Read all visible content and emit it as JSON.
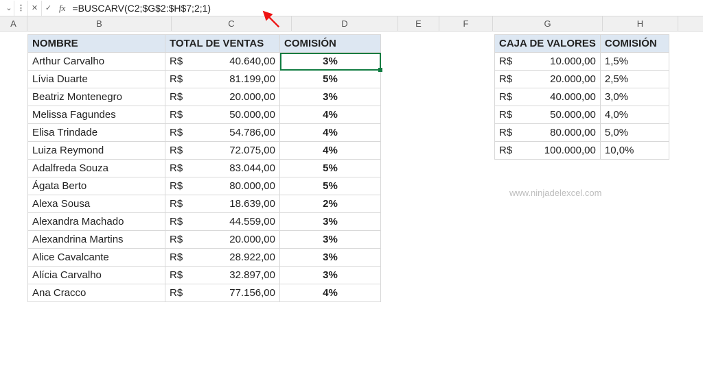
{
  "formula_bar": {
    "dropdown_icon": "⌄",
    "cancel_icon": "✕",
    "accept_icon": "✓",
    "fx_label": "fx",
    "formula": "=BUSCARV(C2;$G$2:$H$7;2;1)"
  },
  "columns": {
    "A": "A",
    "B": "B",
    "C": "C",
    "D": "D",
    "E": "E",
    "F": "F",
    "G": "G",
    "H": "H"
  },
  "main": {
    "headers": {
      "name": "NOMBRE",
      "total": "TOTAL DE VENTAS",
      "comm": "COMISIÓN"
    },
    "currency": "R$",
    "rows": [
      {
        "name": "Arthur Carvalho",
        "total": "40.640,00",
        "pct": "3%"
      },
      {
        "name": "Lívia Duarte",
        "total": "81.199,00",
        "pct": "5%"
      },
      {
        "name": "Beatriz Montenegro",
        "total": "20.000,00",
        "pct": "3%"
      },
      {
        "name": "Melissa Fagundes",
        "total": "50.000,00",
        "pct": "4%"
      },
      {
        "name": "Elisa Trindade",
        "total": "54.786,00",
        "pct": "4%"
      },
      {
        "name": "Luiza Reymond",
        "total": "72.075,00",
        "pct": "4%"
      },
      {
        "name": "Adalfreda Souza",
        "total": "83.044,00",
        "pct": "5%"
      },
      {
        "name": "Ágata Berto",
        "total": "80.000,00",
        "pct": "5%"
      },
      {
        "name": "Alexa Sousa",
        "total": "18.639,00",
        "pct": "2%"
      },
      {
        "name": "Alexandra Machado",
        "total": "44.559,00",
        "pct": "3%"
      },
      {
        "name": "Alexandrina Martins",
        "total": "20.000,00",
        "pct": "3%"
      },
      {
        "name": "Alice Cavalcante",
        "total": "28.922,00",
        "pct": "3%"
      },
      {
        "name": "Alícia Carvalho",
        "total": "32.897,00",
        "pct": "3%"
      },
      {
        "name": "Ana Cracco",
        "total": "77.156,00",
        "pct": "4%"
      }
    ]
  },
  "side": {
    "headers": {
      "caja": "CAJA DE VALORES",
      "comm": "COMISIÓN"
    },
    "currency": "R$",
    "rows": [
      {
        "val": "10.000,00",
        "pct": "1,5%"
      },
      {
        "val": "20.000,00",
        "pct": "2,5%"
      },
      {
        "val": "40.000,00",
        "pct": "3,0%"
      },
      {
        "val": "50.000,00",
        "pct": "4,0%"
      },
      {
        "val": "80.000,00",
        "pct": "5,0%"
      },
      {
        "val": "100.000,00",
        "pct": "10,0%"
      }
    ]
  },
  "watermark": "www.ninjadelexcel.com"
}
